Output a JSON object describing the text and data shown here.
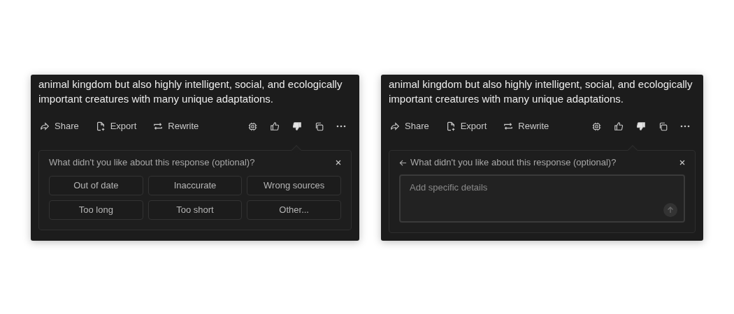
{
  "panels": [
    {
      "kind": "options",
      "message": "animal kingdom but also highly intelligent, social, and ecologically important creatures with many unique adaptations.",
      "actions": [
        "Share",
        "Export",
        "Rewrite"
      ],
      "votes": [
        {
          "selected": false
        },
        {
          "selected": true
        }
      ],
      "feedback": {
        "back": false,
        "question": "What didn't you like about this response (optional)?",
        "options": [
          "Out of date",
          "Inaccurate",
          "Wrong sources",
          "Too long",
          "Too short",
          "Other..."
        ]
      }
    },
    {
      "kind": "details",
      "message": "animal kingdom but also highly intelligent, social, and ecologically important creatures with many unique adaptations.",
      "actions": [
        "Share",
        "Export",
        "Rewrite"
      ],
      "votes": [
        {
          "selected": false
        },
        {
          "selected": true
        }
      ],
      "feedback": {
        "back": true,
        "question": "What didn't you like about this response (optional)?",
        "placeholder": "Add specific details"
      }
    }
  ]
}
